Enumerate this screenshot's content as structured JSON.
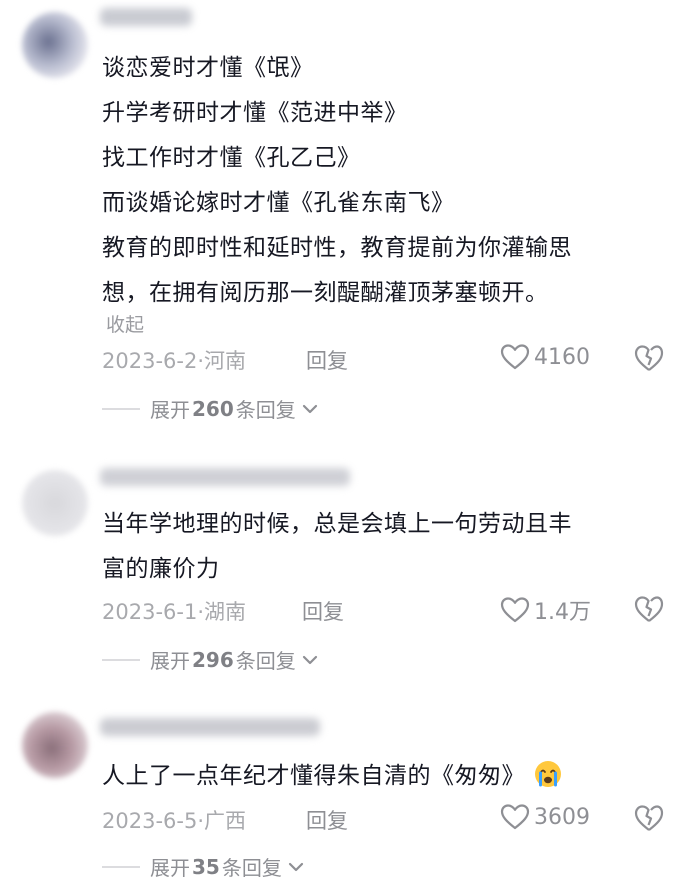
{
  "comments": [
    {
      "lines": [
        "谈恋爱时才懂《氓》",
        "升学考研时才懂《范进中举》",
        "找工作时才懂《孔乙己》",
        "而谈婚论嫁时才懂《孔雀东南飞》",
        "教育的即时性和延时性，教育提前为你灌输思",
        "想，在拥有阅历那一刻醍醐灌顶茅塞顿开。"
      ],
      "collapse_label": "收起",
      "date": "2023-6-2",
      "location": "河南",
      "reply_label": "回复",
      "likes": "4160",
      "expand_prefix": "展开",
      "expand_count": "260",
      "expand_suffix": "条回复"
    },
    {
      "lines": [
        "当年学地理的时候，总是会填上一句劳动且丰",
        "富的廉价力"
      ],
      "date": "2023-6-1",
      "location": "湖南",
      "reply_label": "回复",
      "likes": "1.4万",
      "expand_prefix": "展开",
      "expand_count": "296",
      "expand_suffix": "条回复"
    },
    {
      "lines": [
        "人上了一点年纪才懂得朱自清的《匆匆》"
      ],
      "emoji": "crying-face-icon",
      "date": "2023-6-5",
      "location": "广西",
      "reply_label": "回复",
      "likes": "3609",
      "expand_prefix": "展开",
      "expand_count": "35",
      "expand_suffix": "条回复"
    }
  ],
  "meta_separator": "·",
  "icons": [
    "heart-icon",
    "broken-heart-icon",
    "chevron-down-icon"
  ],
  "colors": {
    "text": "#161823",
    "meta": "#a8a9ad",
    "icon": "#8e8f94"
  }
}
